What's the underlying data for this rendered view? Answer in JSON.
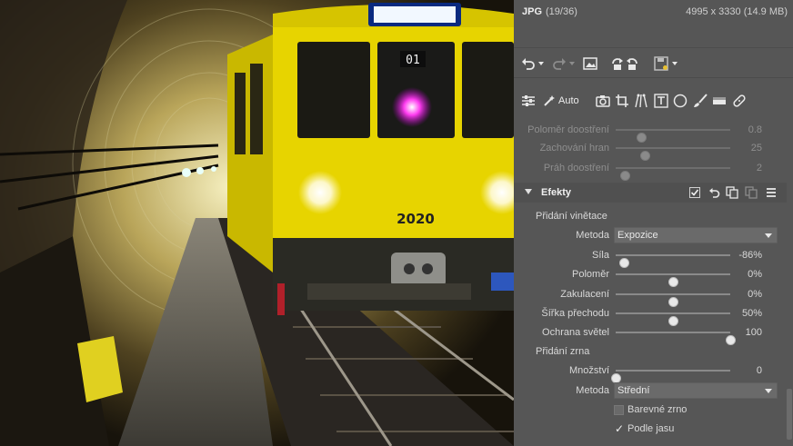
{
  "photo": {
    "sign_text": "",
    "train_number": "2020",
    "window_number": "01"
  },
  "info": {
    "format": "JPG",
    "index": "(19/36)",
    "dimensions": "4995 x 3330 (14.9 MB)"
  },
  "toolbar": {
    "auto_label": "Auto"
  },
  "sharpen": [
    {
      "label": "Poloměr doostření",
      "value": "0.8",
      "fraction": 0.22
    },
    {
      "label": "Zachování hran",
      "value": "25",
      "fraction": 0.25
    },
    {
      "label": "Práh doostření",
      "value": "2",
      "fraction": 0.08
    }
  ],
  "effects": {
    "title": "Efekty",
    "vignette": {
      "title": "Přidání vinětace",
      "method_label": "Metoda",
      "method_value": "Expozice",
      "sliders": [
        {
          "label": "Síla",
          "value": "-86%",
          "fraction": 0.07
        },
        {
          "label": "Poloměr",
          "value": "0%",
          "fraction": 0.5
        },
        {
          "label": "Zakulacení",
          "value": "0%",
          "fraction": 0.5
        },
        {
          "label": "Šířka přechodu",
          "value": "50%",
          "fraction": 0.5
        },
        {
          "label": "Ochrana světel",
          "value": "100",
          "fraction": 1.0
        }
      ]
    },
    "grain": {
      "title": "Přidání zrna",
      "amount_label": "Množství",
      "amount_value": "0",
      "amount_fraction": 0.0,
      "method_label": "Metoda",
      "method_value": "Střední",
      "color_grain_label": "Barevné zrno",
      "color_grain_checked": false,
      "by_brightness_label": "Podle jasu",
      "by_brightness_checked": true
    }
  },
  "colors": {
    "panel_bg": "#565656",
    "train_yellow": "#e7d400",
    "sign_blue": "#2f6bff"
  }
}
